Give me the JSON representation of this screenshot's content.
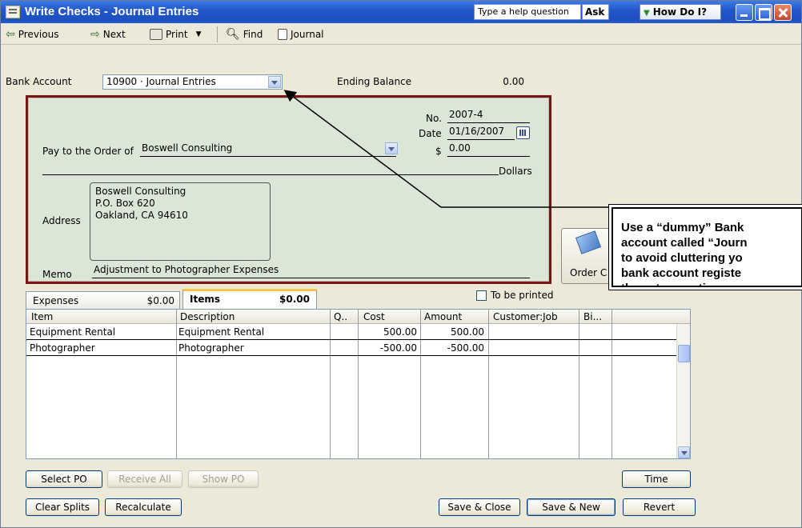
{
  "window": {
    "title": "Write Checks - Journal Entries"
  },
  "help": {
    "placeholder": "Type a help question",
    "ask": "Ask",
    "how_do_i": "How Do I?"
  },
  "toolbar": {
    "previous": "Previous",
    "next": "Next",
    "print": "Print",
    "find": "Find",
    "journal": "Journal"
  },
  "header": {
    "bank_account_label": "Bank Account",
    "bank_account_value": "10900 · Journal Entries",
    "ending_balance_label": "Ending Balance",
    "ending_balance_value": "0.00"
  },
  "check": {
    "no_label": "No.",
    "no_value": "2007-4",
    "date_label": "Date",
    "date_value": "01/16/2007",
    "pay_to_label": "Pay to the Order of",
    "payee": "Boswell Consulting",
    "amount_symbol": "$",
    "amount": "0.00",
    "dollars_label": "Dollars",
    "address_label": "Address",
    "address_lines": [
      "Boswell Consulting",
      "P.O. Box 620",
      "Oakland, CA 94610"
    ],
    "memo_label": "Memo",
    "memo": "Adjustment to Photographer Expenses"
  },
  "order_checks": "Order C",
  "callout": {
    "lines": [
      "Use a “dummy” Bank",
      "account called “Journ",
      "to avoid cluttering yo",
      "bank account registe",
      "these transactions."
    ]
  },
  "tabs": {
    "expenses": {
      "label": "Expenses",
      "amount": "$0.00"
    },
    "items": {
      "label": "Items",
      "amount": "$0.00"
    }
  },
  "to_be_printed": "To be printed",
  "grid": {
    "headers": [
      "Item",
      "Description",
      "Q..",
      "Cost",
      "Amount",
      "Customer:Job",
      "Bi..."
    ],
    "rows": [
      {
        "item": "Equipment Rental",
        "description": "Equipment Rental",
        "qty": "",
        "cost": "500.00",
        "amount": "500.00",
        "customer_job": "",
        "billable": ""
      },
      {
        "item": "Photographer",
        "description": "Photographer",
        "qty": "",
        "cost": "-500.00",
        "amount": "-500.00",
        "customer_job": "",
        "billable": ""
      }
    ]
  },
  "buttons": {
    "select_po": "Select PO",
    "receive_all": "Receive All",
    "show_po": "Show PO",
    "time": "Time",
    "clear_splits": "Clear Splits",
    "recalculate": "Recalculate",
    "save_close": "Save & Close",
    "save_new": "Save & New",
    "revert": "Revert"
  },
  "colors": {
    "title_bar": "#2458c8",
    "check_bg": "#dce6d6",
    "check_border": "#7a1515",
    "tab_highlight": "#f7c54a"
  }
}
